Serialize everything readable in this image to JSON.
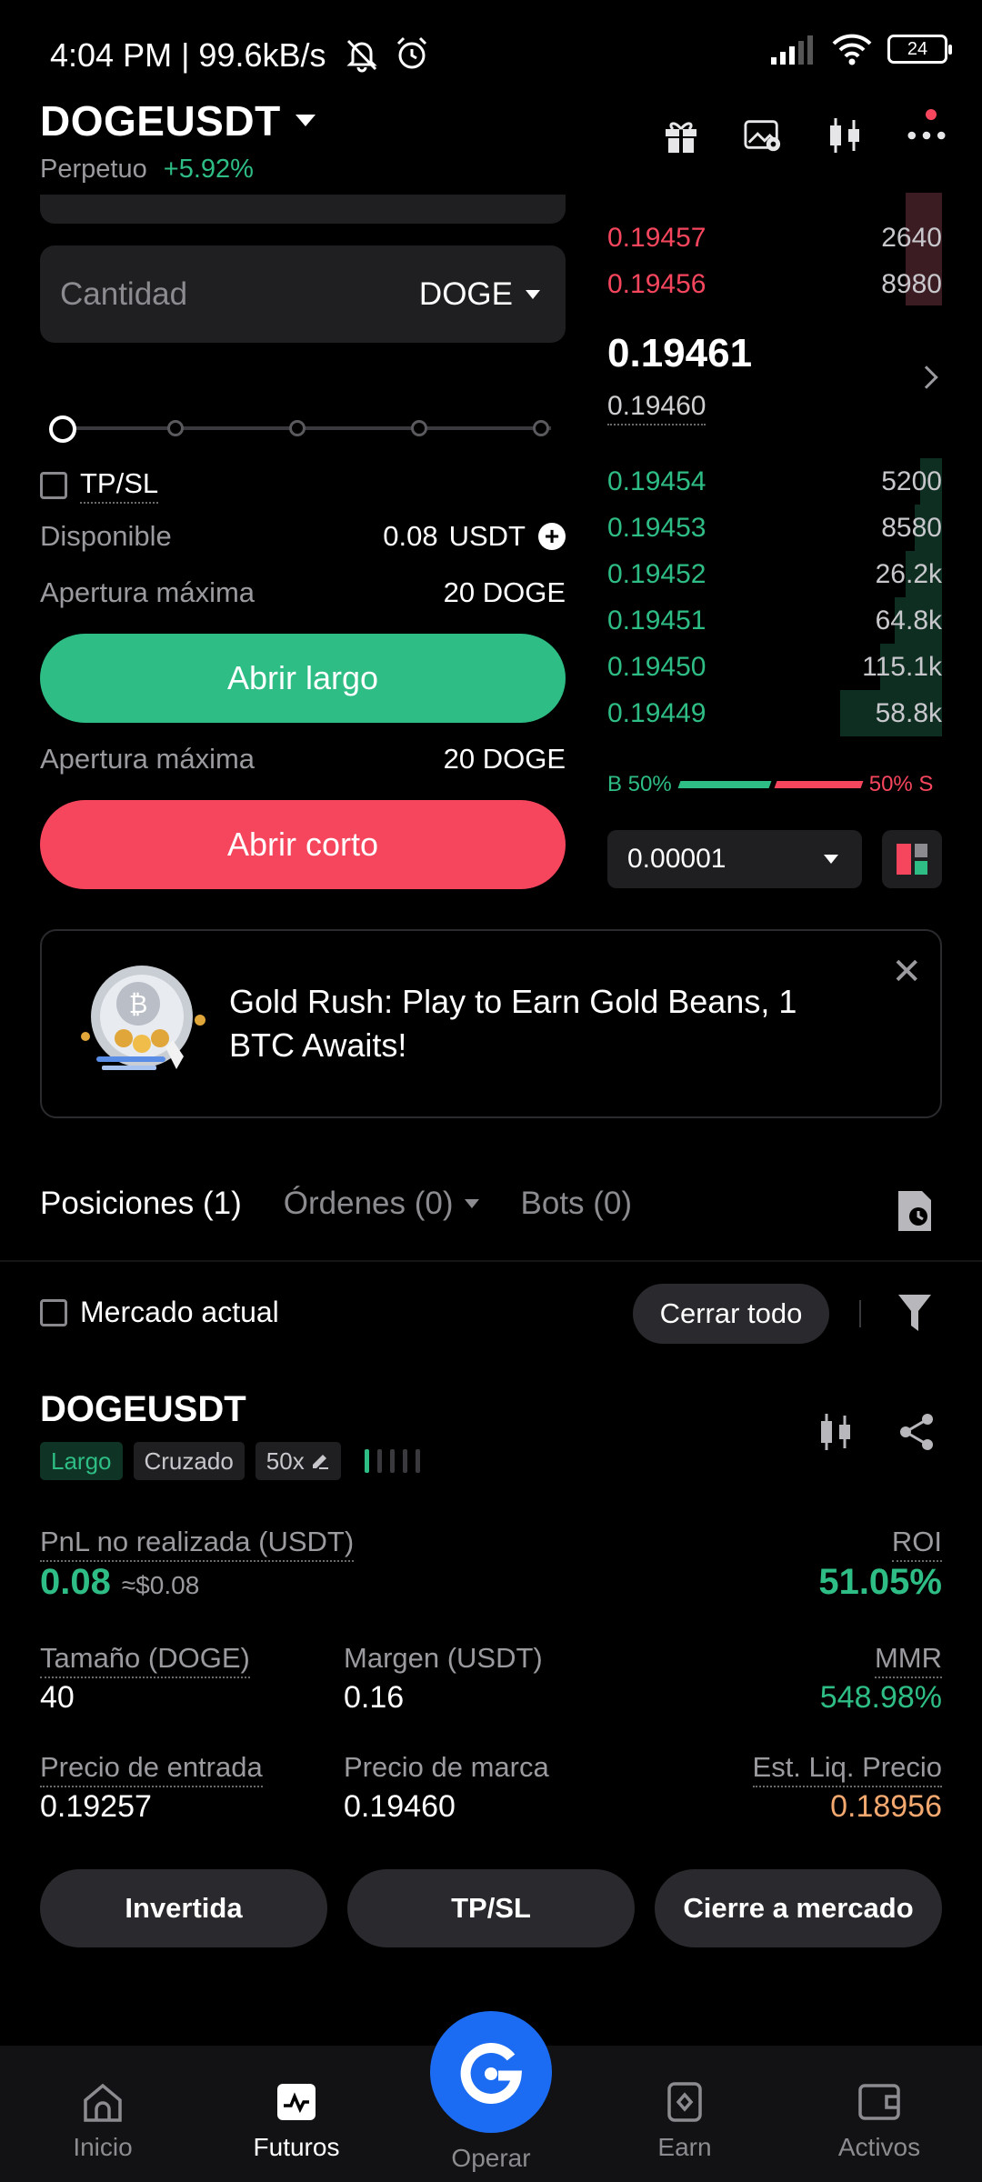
{
  "status_bar": {
    "time_speed": "4:04 PM | 99.6kB/s",
    "battery": "24"
  },
  "header": {
    "pair": "DOGEUSDT",
    "type": "Perpetuo",
    "change": "+5.92%"
  },
  "order_form": {
    "quantity_placeholder": "Cantidad",
    "quantity_unit": "DOGE",
    "slider_percent": 0,
    "tpsl_label": "TP/SL",
    "disponible_label": "Disponible",
    "disponible_value": "0.08",
    "disponible_unit": "USDT",
    "apertura_label_1": "Apertura máxima",
    "apertura_value_1": "20 DOGE",
    "open_long_label": "Abrir largo",
    "apertura_label_2": "Apertura máxima",
    "apertura_value_2": "20 DOGE",
    "open_short_label": "Abrir corto"
  },
  "order_book": {
    "asks": [
      {
        "price": "0.19457",
        "qty": "2640"
      },
      {
        "price": "0.19456",
        "qty": "8980"
      }
    ],
    "last_price": "0.19461",
    "mark_price": "0.19460",
    "bids": [
      {
        "price": "0.19454",
        "qty": "5200"
      },
      {
        "price": "0.19453",
        "qty": "8580"
      },
      {
        "price": "0.19452",
        "qty": "26.2k"
      },
      {
        "price": "0.19451",
        "qty": "64.8k"
      },
      {
        "price": "0.19450",
        "qty": "115.1k"
      },
      {
        "price": "0.19449",
        "qty": "58.8k"
      }
    ],
    "buy_ratio": "B 50%",
    "sell_ratio": "50% S",
    "tick_size": "0.00001"
  },
  "promo": {
    "text": "Gold Rush: Play to Earn Gold Beans, 1 BTC Awaits!"
  },
  "tabs": {
    "positions": "Posiciones (1)",
    "orders": "Órdenes (0)",
    "bots": "Bots (0)"
  },
  "filters": {
    "current_market": "Mercado actual",
    "close_all": "Cerrar todo"
  },
  "position": {
    "symbol": "DOGEUSDT",
    "side": "Largo",
    "margin_mode": "Cruzado",
    "leverage": "50x",
    "pnl_label": "PnL no realizada (USDT)",
    "pnl_value": "0.08",
    "pnl_usd": "≈$0.08",
    "roi_label": "ROI",
    "roi_value": "51.05%",
    "size_label": "Tamaño (DOGE)",
    "size_value": "40",
    "margin_label": "Margen (USDT)",
    "margin_value": "0.16",
    "mmr_label": "MMR",
    "mmr_value": "548.98%",
    "entry_label": "Precio de entrada",
    "entry_value": "0.19257",
    "mark_label": "Precio de marca",
    "mark_value": "0.19460",
    "liq_label": "Est. Liq. Precio",
    "liq_value": "0.18956",
    "btn_reverse": "Invertida",
    "btn_tpsl": "TP/SL",
    "btn_close_market": "Cierre a mercado"
  },
  "bottom_nav": {
    "inicio": "Inicio",
    "futuros": "Futuros",
    "operar": "Operar",
    "earn": "Earn",
    "activos": "Activos"
  },
  "colors": {
    "green": "#2ebd85",
    "red": "#f6465d",
    "liq_orange": "#f3a86f",
    "accent_blue": "#1b6cf2"
  }
}
